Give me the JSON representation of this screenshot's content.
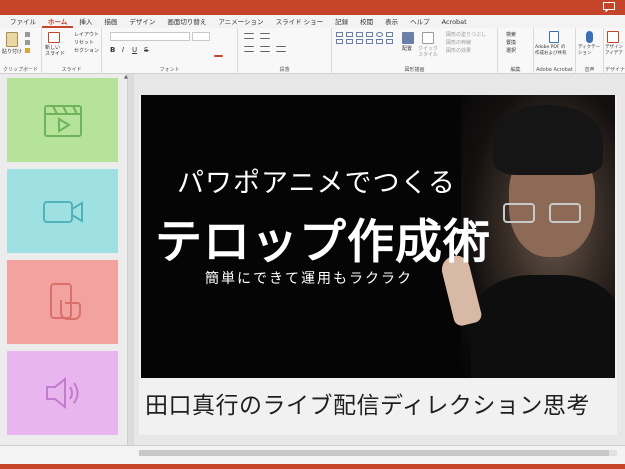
{
  "ribbon": {
    "tabs": [
      {
        "label": "ファイル"
      },
      {
        "label": "ホーム"
      },
      {
        "label": "挿入"
      },
      {
        "label": "描画"
      },
      {
        "label": "デザイン"
      },
      {
        "label": "画面切り替え"
      },
      {
        "label": "アニメーション"
      },
      {
        "label": "スライド ショー"
      },
      {
        "label": "記録"
      },
      {
        "label": "校閲"
      },
      {
        "label": "表示"
      },
      {
        "label": "ヘルプ"
      },
      {
        "label": "Acrobat"
      }
    ],
    "active_tab": "ホーム",
    "clipboard": {
      "paste_label": "貼り付け",
      "group_label": "クリップボード"
    },
    "slides": {
      "new_slide_label": "新しい\nスライド",
      "layout_label": "レイアウト",
      "reset_label": "リセット",
      "section_label": "セクション",
      "group_label": "スライド"
    },
    "font": {
      "group_label": "フォント"
    },
    "paragraph": {
      "group_label": "段落"
    },
    "drawing": {
      "arrange_label": "配置",
      "quick_styles_label": "クイック\nスタイル",
      "fill_label": "図形の塗りつぶし",
      "outline_label": "図形の枠線",
      "effects_label": "図形の効果",
      "group_label": "図形描画"
    },
    "editing": {
      "find_label": "検索",
      "replace_label": "置換",
      "select_label": "選択",
      "group_label": "編集"
    },
    "acrobat": {
      "create_pdf_label": "Adobe PDF の\n作成および共有",
      "group_label": "Adobe Acrobat"
    },
    "voice": {
      "dictate_label": "ディクテー\nション",
      "group_label": "音声"
    },
    "designer": {
      "ideas_label": "デザイン\nアイデア",
      "group_label": "デザイナー"
    }
  },
  "thumbnails": [
    {
      "icon": "clapperboard-icon",
      "color": "#b6e39a",
      "icon_color": "#6fb35a"
    },
    {
      "icon": "video-camera-icon",
      "color": "#9fe0e3",
      "icon_color": "#4fb3b8"
    },
    {
      "icon": "touch-phone-icon",
      "color": "#f2a39f",
      "icon_color": "#d9706b"
    },
    {
      "icon": "speaker-icon",
      "color": "#e8b5ee",
      "icon_color": "#c27ccd"
    }
  ],
  "slide": {
    "headline": "パワポアニメでつくる",
    "title": "テロップ作成術",
    "subtitle": "簡単にできて運用もラクラク",
    "caption": "田口真行のライブ配信ディレクション思考"
  },
  "colors": {
    "accent": "#c4452a",
    "slide_bg": "#050505"
  }
}
